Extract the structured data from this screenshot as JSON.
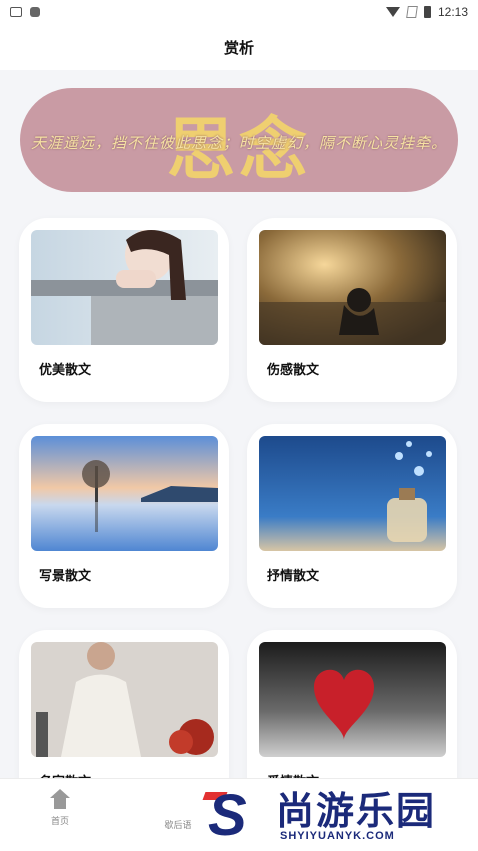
{
  "status_bar": {
    "time": "12:13"
  },
  "header": {
    "title": "赏析"
  },
  "banner": {
    "big_text": "思念",
    "line_text": "天涯遥远，挡不住彼此思念；时空虚幻，隔不断心灵挂牵。"
  },
  "cards": [
    {
      "label": "优美散文"
    },
    {
      "label": "伤感散文"
    },
    {
      "label": "写景散文"
    },
    {
      "label": "抒情散文"
    },
    {
      "label": "名家散文"
    },
    {
      "label": "爱情散文"
    }
  ],
  "tabbar": {
    "items": [
      {
        "label": "首页",
        "icon": "home-icon"
      },
      {
        "label": "歇后语",
        "icon": "grid-icon"
      }
    ]
  },
  "watermark": {
    "brand": "尚游乐园",
    "url": "SHYIYUANYK.COM",
    "letter": "S"
  }
}
